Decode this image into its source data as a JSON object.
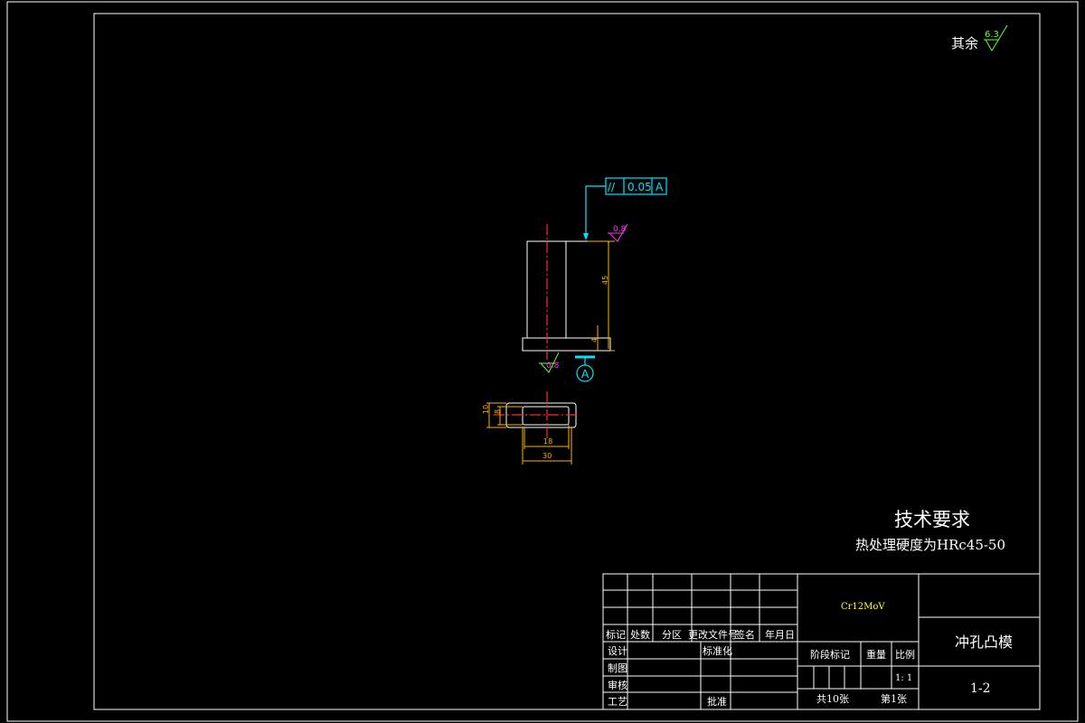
{
  "surface_roughness_note": {
    "label": "其余",
    "value": "6.3"
  },
  "tolerance_frame": {
    "symbol": "//",
    "value": "0.05",
    "datum": "A"
  },
  "roughness_top": "0.8",
  "roughness_bottom": "0.8",
  "datum_label": "A",
  "dimensions": {
    "height": "45",
    "small": "4",
    "width_10": "10",
    "width_8": "8",
    "len_18": "18",
    "len_30": "30"
  },
  "technical_requirements": {
    "title": "技术要求",
    "line1": "热处理硬度为HRc45-50"
  },
  "title_block": {
    "material": "Cr12MoV",
    "part_name": "冲孔凸模",
    "drawing_no": "1-2",
    "headers": [
      "标记",
      "处数",
      "分区",
      "更改文件号",
      "签名",
      "年月日"
    ],
    "rows": [
      "设计",
      "制图",
      "审核",
      "工艺"
    ],
    "standardization": "标准化",
    "approve": "批准",
    "stage_mark": "阶段标记",
    "weight": "重量",
    "scale_label": "比例",
    "scale": "1: 1",
    "sheets_total": "共10张",
    "sheet_no": "第1张"
  }
}
